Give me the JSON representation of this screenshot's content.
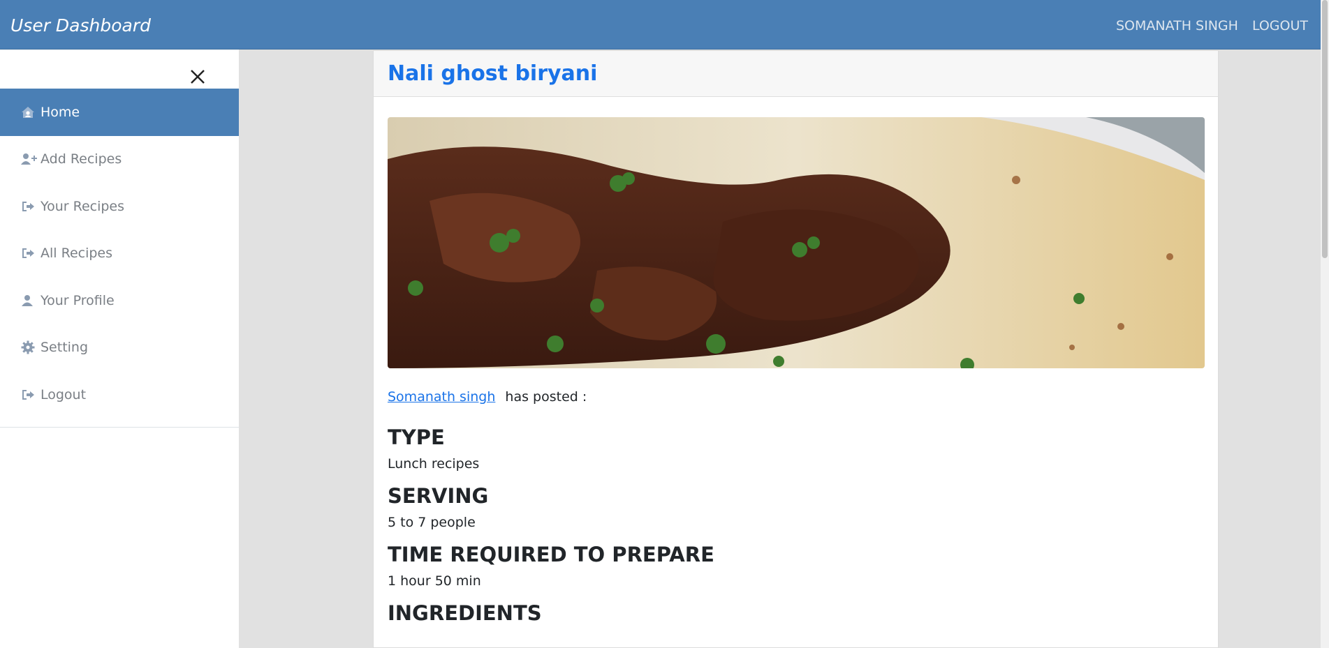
{
  "navbar": {
    "brand": "User Dashboard",
    "user_name": "SOMANATH SINGH",
    "logout": "LOGOUT"
  },
  "sidebar": {
    "close_icon": "close-icon",
    "items": [
      {
        "label": "Home",
        "icon": "home-icon",
        "active": true
      },
      {
        "label": "Add Recipes",
        "icon": "user-plus-icon"
      },
      {
        "label": "Your Recipes",
        "icon": "sign-out-icon"
      },
      {
        "label": "All Recipes",
        "icon": "sign-out-icon"
      },
      {
        "label": "Your Profile",
        "icon": "user-icon"
      },
      {
        "label": "Setting",
        "icon": "gear-icon"
      },
      {
        "label": "Logout",
        "icon": "sign-out-icon"
      }
    ]
  },
  "recipe": {
    "title": "Nali ghost biryani",
    "author_link": "Somanath singh",
    "posted_text": "has posted :",
    "type_heading": "TYPE",
    "type_value": "Lunch recipes",
    "serving_heading": "SERVING",
    "serving_value": "5 to 7 people",
    "time_heading": "TIME REQUIRED TO PREPARE",
    "time_value": "1 hour 50 min",
    "ingredients_heading": "INGREDIENTS"
  },
  "colors": {
    "navbar": "#4a7fb5",
    "link": "#1a73e8",
    "page_bg": "#e1e1e1"
  }
}
